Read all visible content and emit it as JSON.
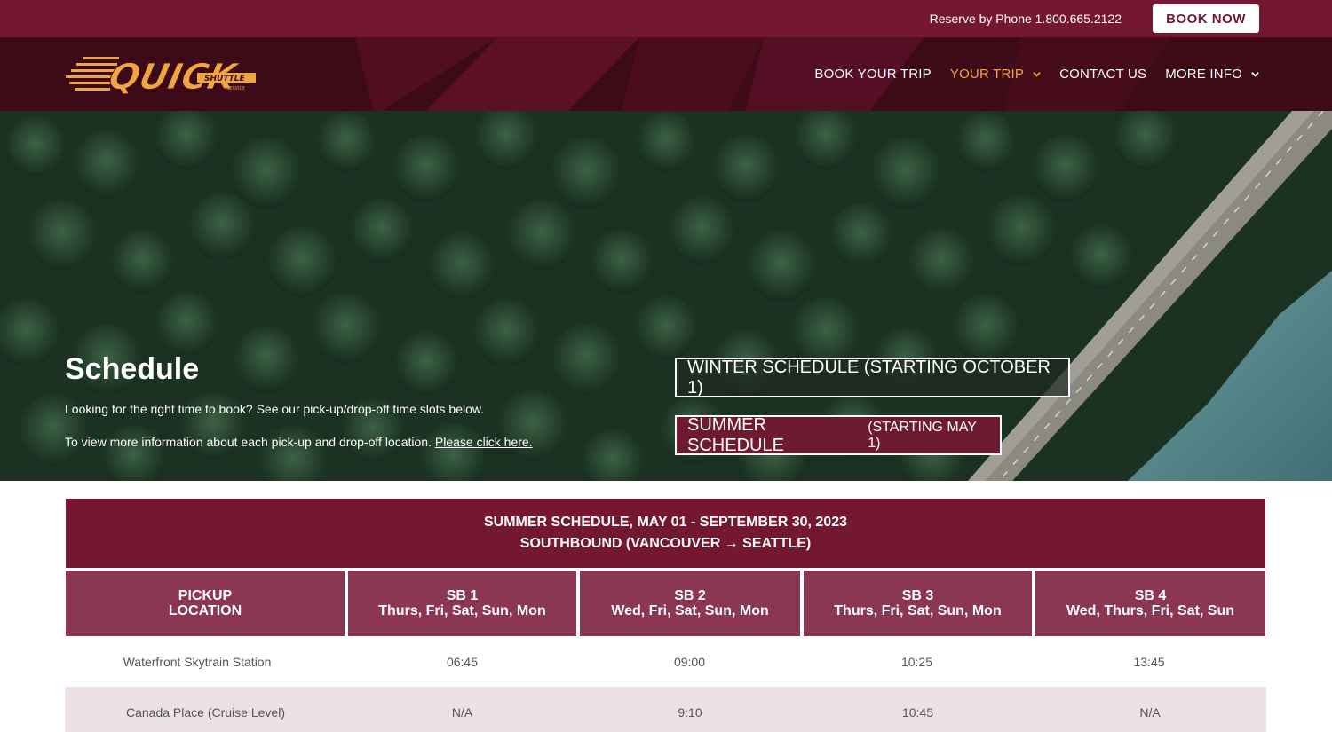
{
  "topbar": {
    "phone_text": "Reserve by Phone 1.800.665.2122",
    "book_now_label": "BOOK NOW"
  },
  "brand": {
    "logo_word": "QUICK",
    "logo_sub": "SHUTTLE",
    "logo_small": "SERVICE",
    "primary_color": "#741731",
    "accent_color": "#f0a640"
  },
  "nav": {
    "items": [
      {
        "label": "BOOK YOUR TRIP"
      },
      {
        "label": "YOUR TRIP"
      },
      {
        "label": "CONTACT US"
      },
      {
        "label": "MORE INFO"
      }
    ]
  },
  "hero": {
    "title": "Schedule",
    "line1": "Looking for the right time to book? See our pick-up/drop-off time slots below.",
    "line2": "To view more information about each pick-up and drop-off location.",
    "link_text": "Please click here.",
    "winter_button": "WINTER SCHEDULE (STARTING OCTOBER 1)",
    "summer_button_main": "SUMMER SCHEDULE",
    "summer_button_small": "(STARTING MAY 1)"
  },
  "schedule": {
    "title_line1": "SUMMER SCHEDULE, MAY 01 - SEPTEMBER 30, 2023",
    "title_line2": "SOUTHBOUND (VANCOUVER → SEATTLE)",
    "columns": [
      {
        "line1": "PICKUP",
        "line2": "LOCATION"
      },
      {
        "line1": "SB 1",
        "line2": "Thurs, Fri, Sat, Sun, Mon"
      },
      {
        "line1": "SB 2",
        "line2": "Wed, Fri, Sat, Sun, Mon"
      },
      {
        "line1": "SB 3",
        "line2": "Thurs, Fri, Sat, Sun, Mon"
      },
      {
        "line1": "SB 4",
        "line2": "Wed, Thurs, Fri, Sat, Sun"
      }
    ],
    "rows": [
      {
        "cells": [
          "Waterfront Skytrain Station",
          "06:45",
          "09:00",
          "10:25",
          "13:45"
        ]
      },
      {
        "cells": [
          "Canada Place (Cruise Level)",
          "N/A",
          "9:10",
          "10:45",
          "N/A"
        ]
      }
    ]
  }
}
